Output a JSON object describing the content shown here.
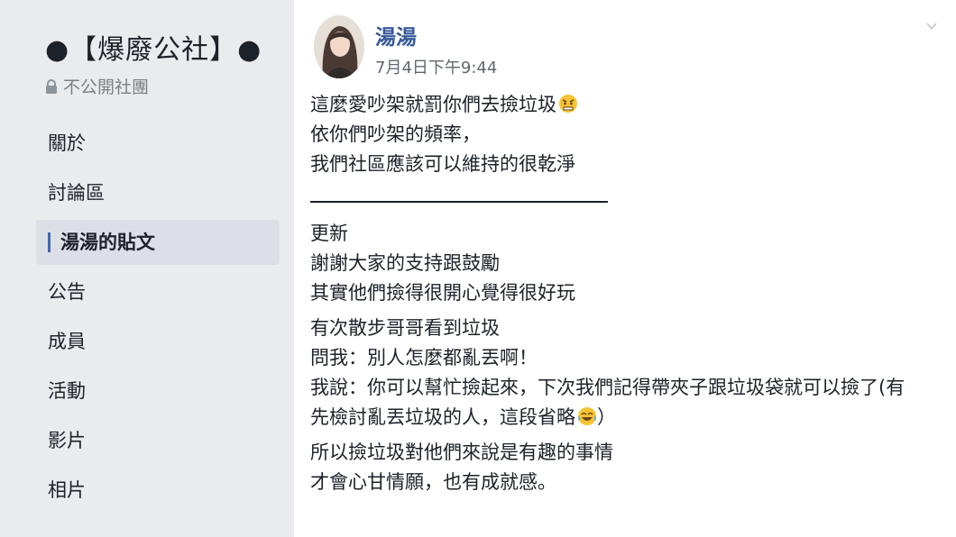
{
  "sidebar": {
    "group_name": "●【爆廢公社】●",
    "privacy_label": "不公開社團",
    "items": [
      {
        "label": "關於"
      },
      {
        "label": "討論區"
      },
      {
        "label": "湯湯的貼文"
      },
      {
        "label": "公告"
      },
      {
        "label": "成員"
      },
      {
        "label": "活動"
      },
      {
        "label": "影片"
      },
      {
        "label": "相片"
      }
    ]
  },
  "post": {
    "author": "湯湯",
    "timestamp": "7月4日下午9:44",
    "lines": [
      "這麼愛吵架就罰你們去撿垃圾",
      "依你們吵架的頻率，",
      "我們社區應該可以維持的很乾淨",
      "更新",
      "謝謝大家的支持跟鼓勵",
      "其實他們撿得很開心覺得很好玩",
      "有次散步哥哥看到垃圾",
      "問我：別人怎麼都亂丟啊！",
      "我說：你可以幫忙撿起來，下次我們記得帶夾子跟垃圾袋就可以撿了(有",
      "先檢討亂丟垃圾的人，這段省略",
      "）",
      "所以撿垃圾對他們來說是有趣的事情",
      "才會心甘情願，也有成就感。"
    ]
  },
  "colors": {
    "link": "#365899",
    "accent": "#4267b2",
    "sidebar_bg": "#e9ebee",
    "active_item_bg": "#dcdfe5"
  },
  "icons": {
    "lock": "lock-icon",
    "chevron": "chevron-down-icon",
    "emoji_1": "angry-face-emoji-icon",
    "emoji_2": "laughing-crying-emoji-icon"
  }
}
